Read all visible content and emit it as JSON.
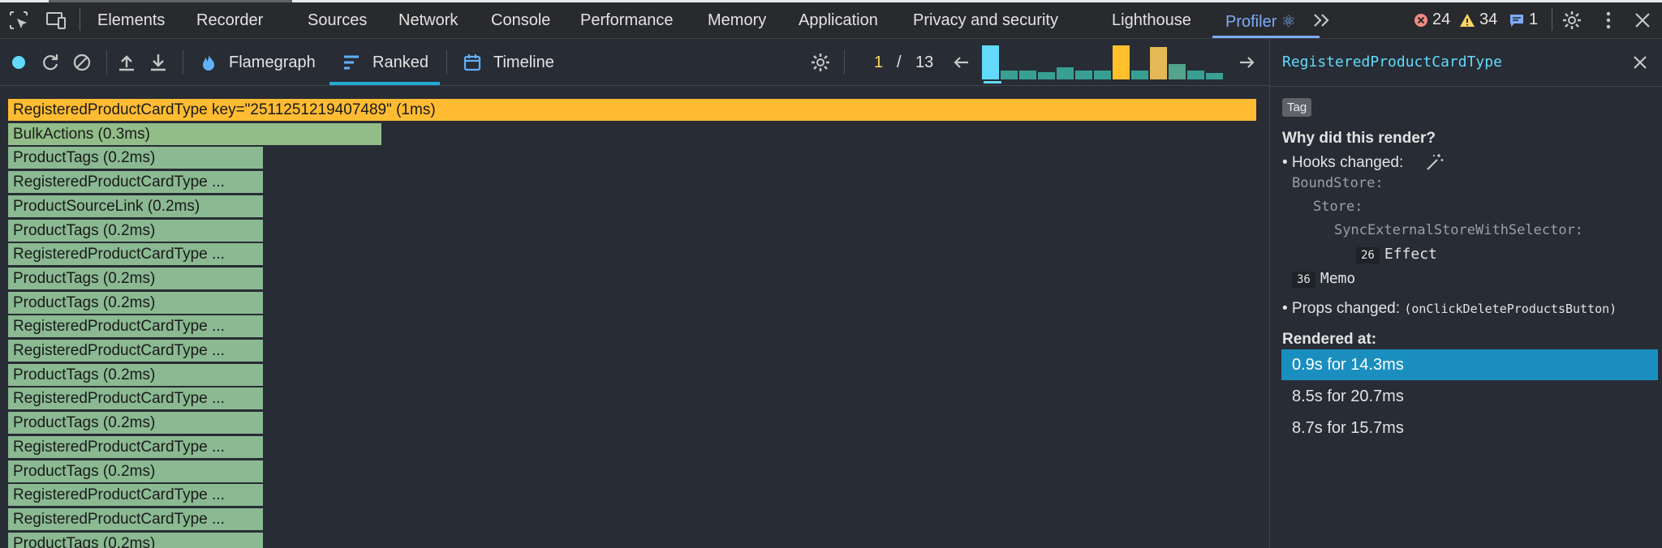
{
  "devtools": {
    "tabs": [
      {
        "label": "Elements"
      },
      {
        "label": "Recorder"
      },
      {
        "label": "Sources"
      },
      {
        "label": "Network"
      },
      {
        "label": "Console"
      },
      {
        "label": "Performance"
      },
      {
        "label": "Memory"
      },
      {
        "label": "Application"
      },
      {
        "label": "Privacy and security"
      },
      {
        "label": "Lighthouse"
      },
      {
        "label": "Profiler ⚛"
      }
    ],
    "errors_count": "24",
    "warnings_count": "34",
    "messages_count": "1",
    "colors": {
      "error": "#f28b82",
      "warning": "#fdd663",
      "info": "#7cacf8",
      "accent": "#7cacf8"
    }
  },
  "toolbar": {
    "views": [
      {
        "label": "Flamegraph",
        "icon": "flame-icon"
      },
      {
        "label": "Ranked",
        "icon": "ranked-icon"
      },
      {
        "label": "Timeline",
        "icon": "calendar-icon"
      }
    ],
    "commit_current": "1",
    "commit_separator": "/",
    "commit_total": "13",
    "commit_bars": [
      {
        "level": 1.0,
        "color": "#61dafb"
      },
      {
        "level": 0.25,
        "color": "#37a093"
      },
      {
        "level": 0.25,
        "color": "#37a093"
      },
      {
        "level": 0.22,
        "color": "#37a093"
      },
      {
        "level": 0.35,
        "color": "#37a093"
      },
      {
        "level": 0.25,
        "color": "#37a093"
      },
      {
        "level": 0.25,
        "color": "#37a093"
      },
      {
        "level": 1.0,
        "color": "#ffc02c"
      },
      {
        "level": 0.25,
        "color": "#37a093"
      },
      {
        "level": 0.95,
        "color": "#e4b955"
      },
      {
        "level": 0.45,
        "color": "#52a48a"
      },
      {
        "level": 0.25,
        "color": "#37a093"
      },
      {
        "level": 0.2,
        "color": "#37a093"
      }
    ]
  },
  "ranked": {
    "rows": [
      {
        "label": "RegisteredProductCardType key=\"2511251219407489\" (1ms)",
        "fraction": 1.0,
        "color": "#ffbc33"
      },
      {
        "label": "BulkActions (0.3ms)",
        "fraction": 0.3,
        "color": "#92bc88"
      },
      {
        "label": "ProductTags (0.2ms)",
        "fraction": 0.2,
        "color": "#8ab992"
      },
      {
        "label": "RegisteredProductCardType ...",
        "fraction": 0.2,
        "color": "#8ab992"
      },
      {
        "label": "ProductSourceLink (0.2ms)",
        "fraction": 0.2,
        "color": "#8ab992"
      },
      {
        "label": "ProductTags (0.2ms)",
        "fraction": 0.2,
        "color": "#8ab992"
      },
      {
        "label": "RegisteredProductCardType ...",
        "fraction": 0.2,
        "color": "#8ab992"
      },
      {
        "label": "ProductTags (0.2ms)",
        "fraction": 0.2,
        "color": "#8ab992"
      },
      {
        "label": "ProductTags (0.2ms)",
        "fraction": 0.2,
        "color": "#8ab992"
      },
      {
        "label": "RegisteredProductCardType ...",
        "fraction": 0.2,
        "color": "#8ab992"
      },
      {
        "label": "RegisteredProductCardType ...",
        "fraction": 0.2,
        "color": "#8ab992"
      },
      {
        "label": "ProductTags (0.2ms)",
        "fraction": 0.2,
        "color": "#8ab992"
      },
      {
        "label": "RegisteredProductCardType ...",
        "fraction": 0.2,
        "color": "#8ab992"
      },
      {
        "label": "ProductTags (0.2ms)",
        "fraction": 0.2,
        "color": "#8ab992"
      },
      {
        "label": "RegisteredProductCardType ...",
        "fraction": 0.2,
        "color": "#8ab992"
      },
      {
        "label": "ProductTags (0.2ms)",
        "fraction": 0.2,
        "color": "#8ab992"
      },
      {
        "label": "RegisteredProductCardType ...",
        "fraction": 0.2,
        "color": "#8ab992"
      },
      {
        "label": "RegisteredProductCardType ...",
        "fraction": 0.2,
        "color": "#8ab992"
      },
      {
        "label": "ProductTags (0.2ms)",
        "fraction": 0.2,
        "color": "#8ab992"
      }
    ]
  },
  "panel": {
    "component_name": "RegisteredProductCardType",
    "tag_label": "Tag",
    "why_title": "Why did this render?",
    "hooks_label": "• Hooks changed:",
    "hook_tree": {
      "bound_store": "BoundStore:",
      "store": "Store:",
      "sync": "SyncExternalStoreWithSelector:",
      "effect_index": "26",
      "effect_name": "Effect",
      "memo_index": "36",
      "memo_name": "Memo"
    },
    "props_label": "• Props changed:",
    "props_value": "(onClickDeleteProductsButton)",
    "rendered_title": "Rendered at:",
    "renders": [
      {
        "label": "0.9s for 14.3ms",
        "selected": true
      },
      {
        "label": "8.5s for 20.7ms",
        "selected": false
      },
      {
        "label": "8.7s for 15.7ms",
        "selected": false
      }
    ]
  }
}
